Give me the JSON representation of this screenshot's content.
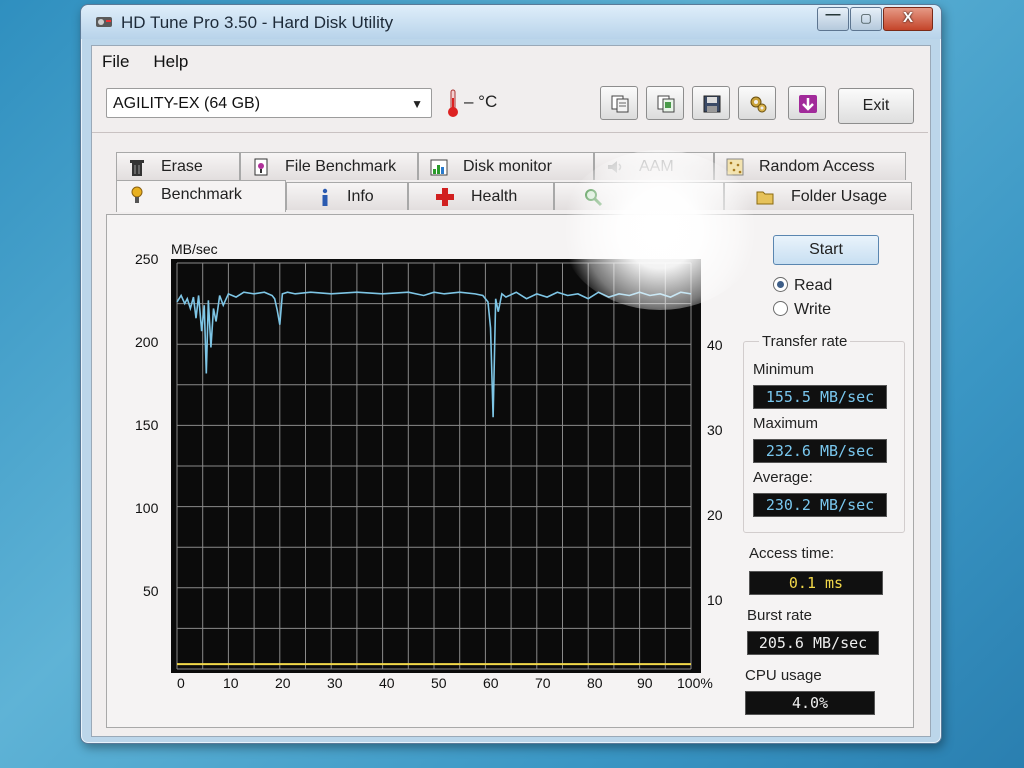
{
  "window": {
    "title": "HD Tune Pro 3.50 - Hard Disk Utility",
    "close_glyph": "X"
  },
  "menu": {
    "file": "File",
    "help": "Help"
  },
  "toolbar": {
    "drive": "AGILITY-EX (64 GB)",
    "temperature": "– °C",
    "exit_label": "Exit",
    "buttons": [
      "copy-text-icon",
      "copy-info-icon",
      "save-icon",
      "options-icon",
      "download-icon"
    ]
  },
  "tabs_back": [
    {
      "label": "Erase",
      "icon": "trash-icon"
    },
    {
      "label": "File Benchmark",
      "icon": "file-benchmark-icon"
    },
    {
      "label": "Disk monitor",
      "icon": "disk-monitor-icon"
    },
    {
      "label": "AAM",
      "icon": "speaker-icon",
      "disabled": true
    },
    {
      "label": "Random Access",
      "icon": "random-access-icon"
    }
  ],
  "tabs_front": [
    {
      "label": "Benchmark",
      "icon": "benchmark-icon",
      "active": true
    },
    {
      "label": "Info",
      "icon": "info-icon"
    },
    {
      "label": "Health",
      "icon": "health-icon"
    },
    {
      "label": "",
      "icon": "search-icon"
    },
    {
      "label": "Folder Usage",
      "icon": "folder-icon"
    }
  ],
  "benchmark": {
    "start_label": "Start",
    "read_label": "Read",
    "write_label": "Write",
    "mode": "read",
    "transfer_rate_title": "Transfer rate",
    "minimum_label": "Minimum",
    "minimum_value": "155.5 MB/sec",
    "maximum_label": "Maximum",
    "maximum_value": "232.6 MB/sec",
    "average_label": "Average:",
    "average_value": "230.2 MB/sec",
    "access_label": "Access time:",
    "access_value": "0.1 ms",
    "burst_label": "Burst rate",
    "burst_value": "205.6 MB/sec",
    "cpu_label": "CPU usage",
    "cpu_value": "4.0%"
  },
  "chart_data": {
    "type": "line",
    "ylabel": "MB/sec",
    "ylim": [
      0,
      250
    ],
    "y_ticks": [
      250,
      200,
      150,
      100,
      50
    ],
    "y2lim": [
      0,
      50
    ],
    "y2_ticks": [
      40,
      30,
      20,
      10
    ],
    "xlim": [
      0,
      100
    ],
    "x_ticks": [
      "0",
      "10",
      "20",
      "30",
      "40",
      "50",
      "60",
      "70",
      "80",
      "90",
      "100%"
    ],
    "grid": true,
    "colors": {
      "transfer": "#7ec6e6",
      "access": "#f2d84a",
      "background": "#0b0b0b",
      "grid": "#8a8a8a"
    },
    "series": [
      {
        "x": [
          0,
          0.8,
          1.5,
          2,
          2.6,
          3.2,
          3.7,
          4.2,
          4.8,
          5.3,
          5.7,
          6.1,
          6.6,
          7.1,
          7.6,
          8.3,
          9,
          10,
          11.5,
          13,
          15,
          17,
          18.5,
          19,
          19.5,
          20,
          20.5,
          21.5,
          23,
          26,
          30,
          35,
          40,
          45,
          48,
          50,
          52,
          55,
          58,
          59.5,
          60.5,
          61,
          61.5,
          62,
          62.5,
          63.2,
          64,
          66,
          68,
          70,
          72,
          74,
          76,
          78,
          80,
          82,
          84,
          86,
          88,
          90,
          92,
          94,
          96,
          98,
          100
        ],
        "y": [
          226,
          230,
          225,
          228,
          222,
          229,
          216,
          230,
          208,
          224,
          182,
          227,
          198,
          222,
          214,
          230,
          224,
          231,
          229,
          232,
          231,
          232,
          230,
          228,
          221,
          212,
          231,
          232,
          231,
          232,
          231,
          232,
          231,
          232,
          230,
          232,
          231,
          232,
          231,
          230,
          226,
          210,
          155,
          228,
          220,
          231,
          229,
          232,
          228,
          231,
          229,
          232,
          230,
          231,
          228,
          232,
          229,
          231,
          230,
          232,
          230,
          231,
          229,
          232,
          231
        ]
      },
      {
        "x": [
          0,
          5,
          10,
          20,
          30,
          40,
          50,
          60,
          70,
          80,
          90,
          100
        ],
        "y": [
          0.6,
          0.6,
          0.6,
          0.6,
          0.6,
          0.6,
          0.6,
          0.6,
          0.6,
          0.6,
          0.6,
          0.6
        ]
      }
    ]
  }
}
